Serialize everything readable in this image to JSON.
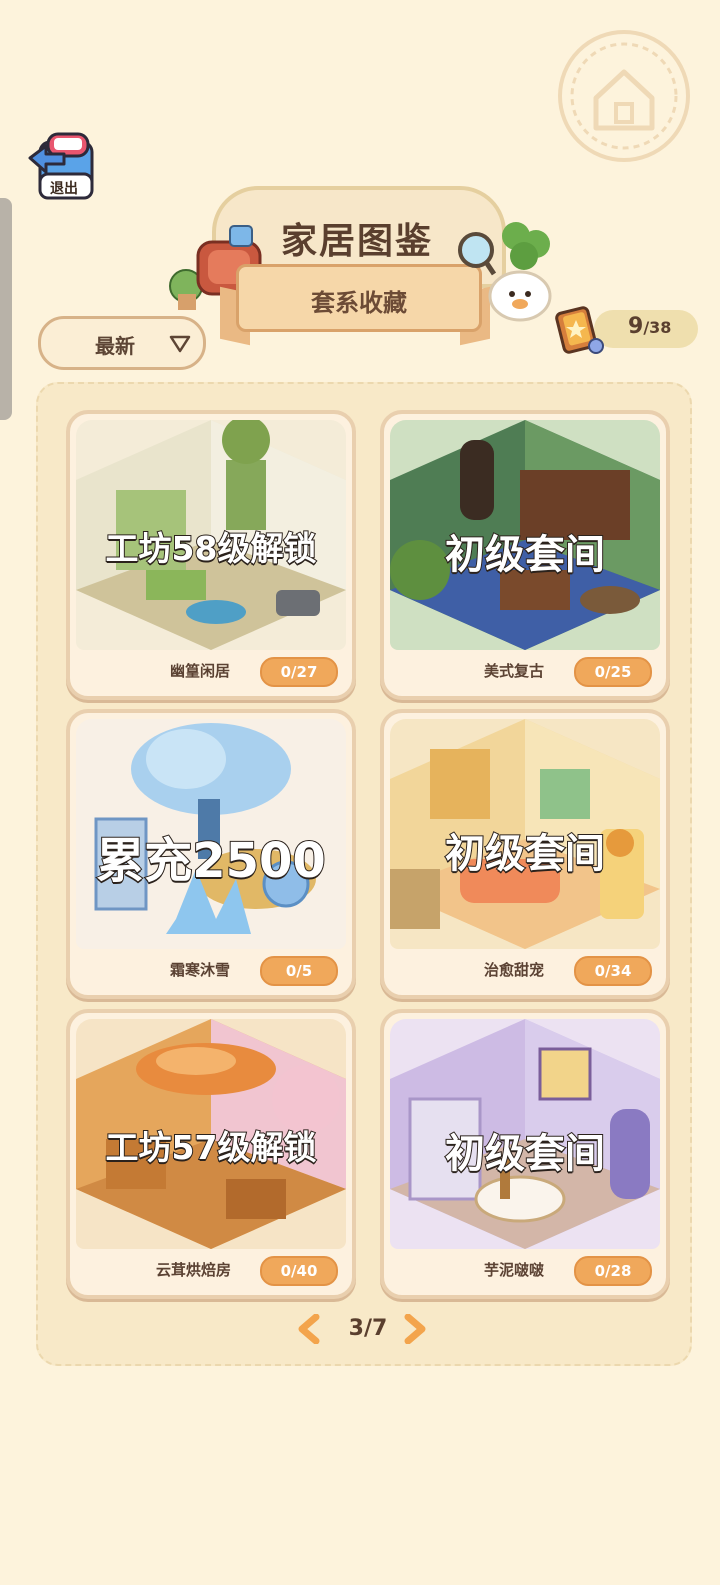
{
  "header": {
    "exit_label": "退出",
    "title": "家居图鉴",
    "subtitle": "套系收藏"
  },
  "sort": {
    "selected": "最新"
  },
  "collection": {
    "collected": "9",
    "total": "/38"
  },
  "cards": [
    {
      "name": "幽篁闲居",
      "progress": "0/27",
      "lock_text": "工坊58级解锁"
    },
    {
      "name": "美式复古",
      "progress": "0/25",
      "lock_text": "初级套间"
    },
    {
      "name": "霜寒沐雪",
      "progress": "0/5",
      "lock_text": "累充2500"
    },
    {
      "name": "治愈甜宠",
      "progress": "0/34",
      "lock_text": "初级套间"
    },
    {
      "name": "云茸烘焙房",
      "progress": "0/40",
      "lock_text": "工坊57级解锁"
    },
    {
      "name": "芋泥啵啵",
      "progress": "0/28",
      "lock_text": "初级套间"
    }
  ],
  "pager": {
    "label": "3/7"
  },
  "colors": {
    "background": "#fdf3dc",
    "accent_orange": "#f0a85b",
    "text_brown": "#5a3f2e"
  }
}
